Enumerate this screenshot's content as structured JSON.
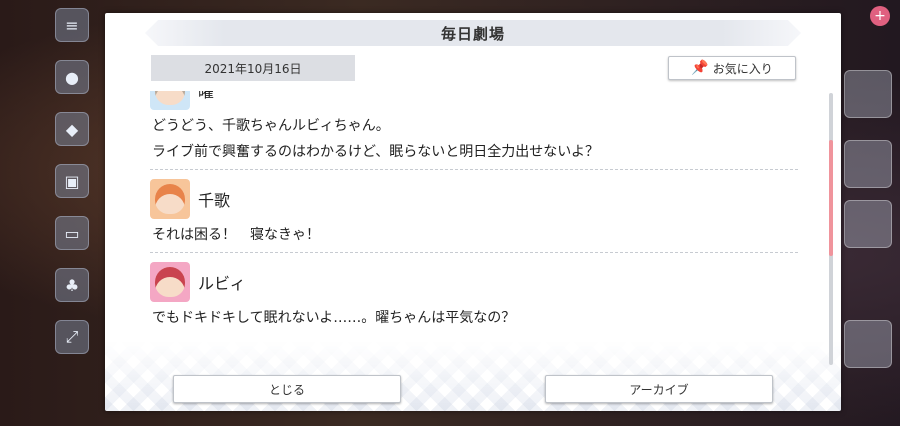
{
  "dialog": {
    "title": "毎日劇場",
    "date": "2021年10月16日",
    "favorite_label": "お気に入り",
    "entries": [
      {
        "speaker": "曜",
        "avatar_color": "#cfe6f7",
        "hair_color": "#b8a99a",
        "lines": [
          "どうどう、千歌ちゃんルビィちゃん。",
          "ライブ前で興奮するのはわかるけど、眠らないと明日全力出せないよ？"
        ]
      },
      {
        "speaker": "千歌",
        "avatar_color": "#f7c59a",
        "hair_color": "#e8834a",
        "lines": [
          "それは困る！　寝なきゃ！"
        ]
      },
      {
        "speaker": "ルビィ",
        "avatar_color": "#f4a7c4",
        "hair_color": "#c9434f",
        "lines": [
          "でもドキドキして眠れないよ……。曜ちゃんは平気なの？"
        ]
      }
    ],
    "close_label": "とじる",
    "archive_label": "アーカイブ"
  },
  "scroll": {
    "position": 0.3
  }
}
